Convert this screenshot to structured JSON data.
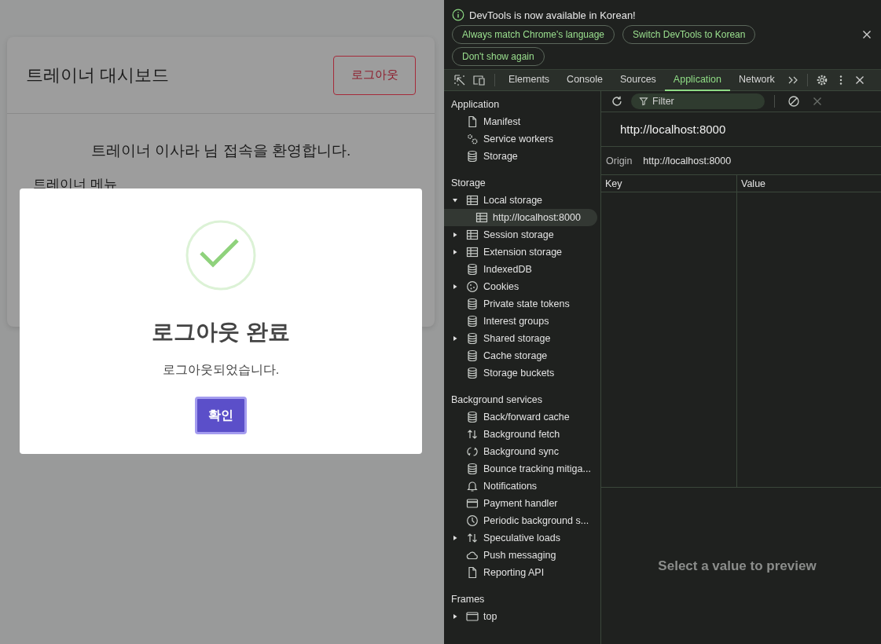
{
  "page": {
    "title": "트레이너 대시보드",
    "logout_button": "로그아웃",
    "welcome": "트레이너 이사라 님 접속을 환영합니다.",
    "menu_heading": "트레이너 메뉴"
  },
  "modal": {
    "title": "로그아웃 완료",
    "message": "로그아웃되었습니다.",
    "confirm_button": "확인"
  },
  "devtools": {
    "infobar": {
      "message": "DevTools is now available in Korean!",
      "buttons": [
        "Always match Chrome's language",
        "Switch DevTools to Korean",
        "Don't show again"
      ]
    },
    "tabs": [
      {
        "label": "Elements",
        "selected": false
      },
      {
        "label": "Console",
        "selected": false
      },
      {
        "label": "Sources",
        "selected": false
      },
      {
        "label": "Application",
        "selected": true
      },
      {
        "label": "Network",
        "selected": false
      }
    ],
    "sidebar": [
      {
        "title": "Application",
        "items": [
          {
            "label": "Manifest",
            "kind": "file",
            "selected": false
          },
          {
            "label": "Service workers",
            "kind": "gears",
            "selected": false
          },
          {
            "label": "Storage",
            "kind": "database",
            "selected": false
          }
        ]
      },
      {
        "title": "Storage",
        "items": [
          {
            "label": "Local storage",
            "kind": "table",
            "selected": false,
            "expanded": true,
            "children": [
              {
                "label": "http://localhost:8000",
                "kind": "table",
                "selected": true
              }
            ]
          },
          {
            "label": "Session storage",
            "kind": "table",
            "selected": false,
            "expanded": false
          },
          {
            "label": "Extension storage",
            "kind": "table",
            "selected": false,
            "expanded": false
          },
          {
            "label": "IndexedDB",
            "kind": "database",
            "selected": false
          },
          {
            "label": "Cookies",
            "kind": "cookie",
            "selected": false,
            "expanded": false
          },
          {
            "label": "Private state tokens",
            "kind": "database",
            "selected": false
          },
          {
            "label": "Interest groups",
            "kind": "database",
            "selected": false
          },
          {
            "label": "Shared storage",
            "kind": "database",
            "selected": false,
            "expanded": false
          },
          {
            "label": "Cache storage",
            "kind": "database",
            "selected": false
          },
          {
            "label": "Storage buckets",
            "kind": "database",
            "selected": false
          }
        ]
      },
      {
        "title": "Background services",
        "items": [
          {
            "label": "Back/forward cache",
            "kind": "database",
            "selected": false
          },
          {
            "label": "Background fetch",
            "kind": "updown",
            "selected": false
          },
          {
            "label": "Background sync",
            "kind": "sync",
            "selected": false
          },
          {
            "label": "Bounce tracking mitiga...",
            "kind": "database",
            "selected": false
          },
          {
            "label": "Notifications",
            "kind": "bell",
            "selected": false
          },
          {
            "label": "Payment handler",
            "kind": "card",
            "selected": false
          },
          {
            "label": "Periodic background s...",
            "kind": "clock",
            "selected": false
          },
          {
            "label": "Speculative loads",
            "kind": "updown",
            "selected": false,
            "expanded": false
          },
          {
            "label": "Push messaging",
            "kind": "cloud",
            "selected": false
          },
          {
            "label": "Reporting API",
            "kind": "file",
            "selected": false
          }
        ]
      },
      {
        "title": "Frames",
        "items": [
          {
            "label": "top",
            "kind": "window",
            "selected": false,
            "expanded": false
          }
        ]
      }
    ],
    "filter": {
      "placeholder": "Filter"
    },
    "origin_title": "http://localhost:8000",
    "origin_label": "Origin",
    "origin_value": "http://localhost:8000",
    "table": {
      "columns": [
        "Key",
        "Value"
      ]
    },
    "preview": "Select a value to preview"
  }
}
